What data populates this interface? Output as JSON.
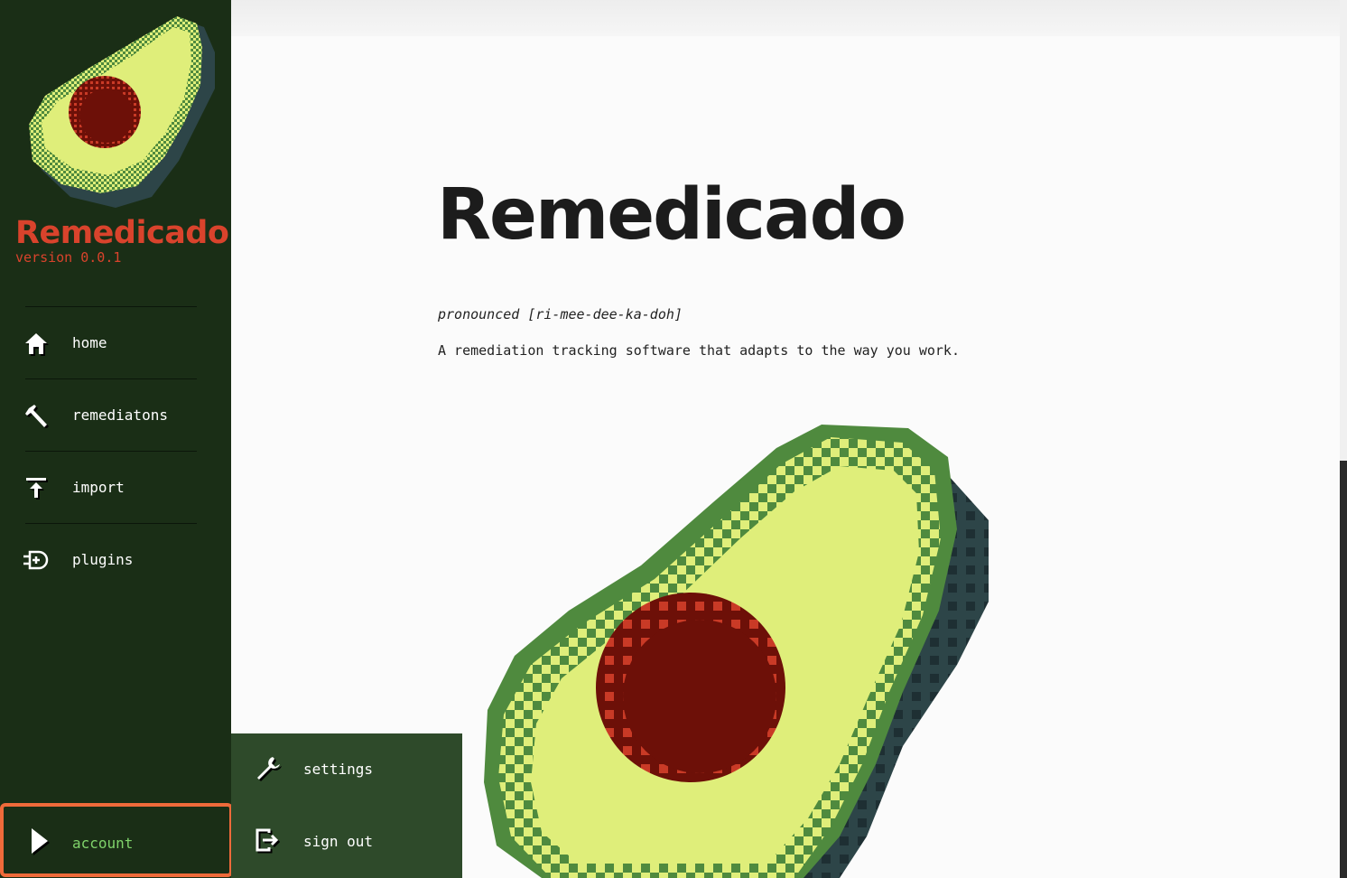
{
  "sidebar": {
    "app_name": "Remedicado",
    "version": "version 0.0.1",
    "nav": [
      {
        "label": "home",
        "icon": "home-icon"
      },
      {
        "label": "remediatons",
        "icon": "hammer-icon"
      },
      {
        "label": "import",
        "icon": "upload-icon"
      },
      {
        "label": "plugins",
        "icon": "plugin-icon"
      }
    ],
    "account": {
      "label": "account",
      "icon": "play-arrow-icon"
    }
  },
  "popup": {
    "items": [
      {
        "label": "settings",
        "icon": "wrench-icon"
      },
      {
        "label": "sign out",
        "icon": "sign-out-icon"
      }
    ]
  },
  "main": {
    "title": "Remedicado",
    "pronunciation": "pronounced [ri-mee-dee-ka-doh]",
    "tagline": "A remediation tracking software that adapts to the way you work."
  },
  "colors": {
    "sidebar_bg": "#1a2e16",
    "brand_red": "#d9432c",
    "account_highlight": "#ef6a3a",
    "account_text": "#7fd36a",
    "popup_bg": "#2e4a2a"
  }
}
